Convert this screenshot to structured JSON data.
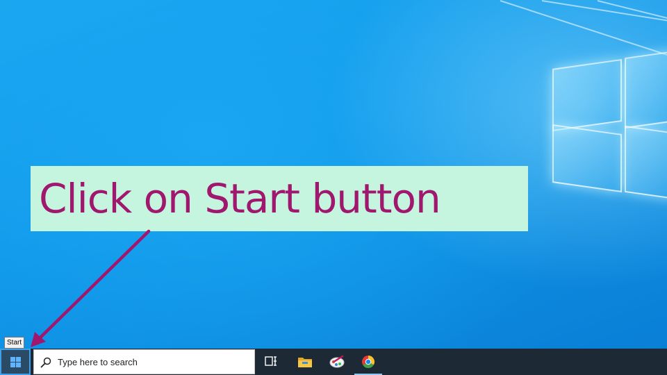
{
  "callout": {
    "text": "Click on Start button"
  },
  "tooltip": {
    "text": "Start"
  },
  "taskbar": {
    "search": {
      "placeholder": "Type here to search"
    },
    "icons": [
      "windows-start-icon",
      "search-icon",
      "task-view-icon",
      "file-explorer-icon",
      "paint-icon",
      "chrome-icon"
    ]
  },
  "colors": {
    "callout_bg": "#c6f5df",
    "callout_text": "#a0186e",
    "arrow": "#a0186e",
    "taskbar": "#1d2a36"
  }
}
